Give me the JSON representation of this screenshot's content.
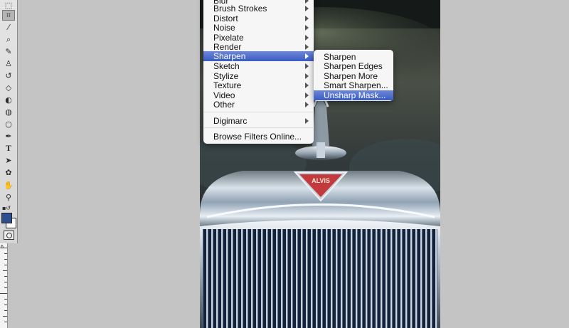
{
  "toolbar": {
    "tools": [
      {
        "name": "marquee-tool-icon",
        "glyph": "⬚"
      },
      {
        "name": "crop-tool-icon",
        "glyph": "⌗"
      },
      {
        "name": "eyedropper-tool-icon",
        "glyph": "⁄"
      },
      {
        "name": "healing-brush-tool-icon",
        "glyph": "⌕"
      },
      {
        "name": "brush-tool-icon",
        "glyph": "✎"
      },
      {
        "name": "clone-stamp-tool-icon",
        "glyph": "♙"
      },
      {
        "name": "history-brush-tool-icon",
        "glyph": "↺"
      },
      {
        "name": "eraser-tool-icon",
        "glyph": "◇"
      },
      {
        "name": "paint-bucket-tool-icon",
        "glyph": "◐"
      },
      {
        "name": "blur-tool-icon",
        "glyph": "◍"
      },
      {
        "name": "dodge-tool-icon",
        "glyph": "○"
      },
      {
        "name": "pen-tool-icon",
        "glyph": "✒"
      },
      {
        "name": "type-tool-icon",
        "glyph": "T"
      },
      {
        "name": "path-selection-tool-icon",
        "glyph": "➤"
      },
      {
        "name": "custom-shape-tool-icon",
        "glyph": "✿"
      },
      {
        "name": "hand-tool-icon",
        "glyph": "✋"
      },
      {
        "name": "zoom-tool-icon",
        "glyph": "⚲"
      }
    ],
    "foreground_color": "#2d4f8f",
    "background_color": "#ffffff",
    "ruler_label": "6"
  },
  "filter_menu": {
    "items": [
      {
        "label": "Blur",
        "submenu": true
      },
      {
        "label": "Brush Strokes",
        "submenu": true
      },
      {
        "label": "Distort",
        "submenu": true
      },
      {
        "label": "Noise",
        "submenu": true
      },
      {
        "label": "Pixelate",
        "submenu": true
      },
      {
        "label": "Render",
        "submenu": true
      },
      {
        "label": "Sharpen",
        "submenu": true,
        "selected": true
      },
      {
        "label": "Sketch",
        "submenu": true
      },
      {
        "label": "Stylize",
        "submenu": true
      },
      {
        "label": "Texture",
        "submenu": true
      },
      {
        "label": "Video",
        "submenu": true
      },
      {
        "label": "Other",
        "submenu": true
      }
    ],
    "digimarc": "Digimarc",
    "browse": "Browse Filters Online..."
  },
  "sharpen_menu": {
    "items": [
      {
        "label": "Sharpen"
      },
      {
        "label": "Sharpen Edges"
      },
      {
        "label": "Sharpen More"
      },
      {
        "label": "Smart Sharpen..."
      },
      {
        "label": "Unsharp Mask...",
        "selected": true
      }
    ]
  },
  "canvas": {
    "badge_text": "ALVIS",
    "selection_color": "#3a5cc4"
  }
}
